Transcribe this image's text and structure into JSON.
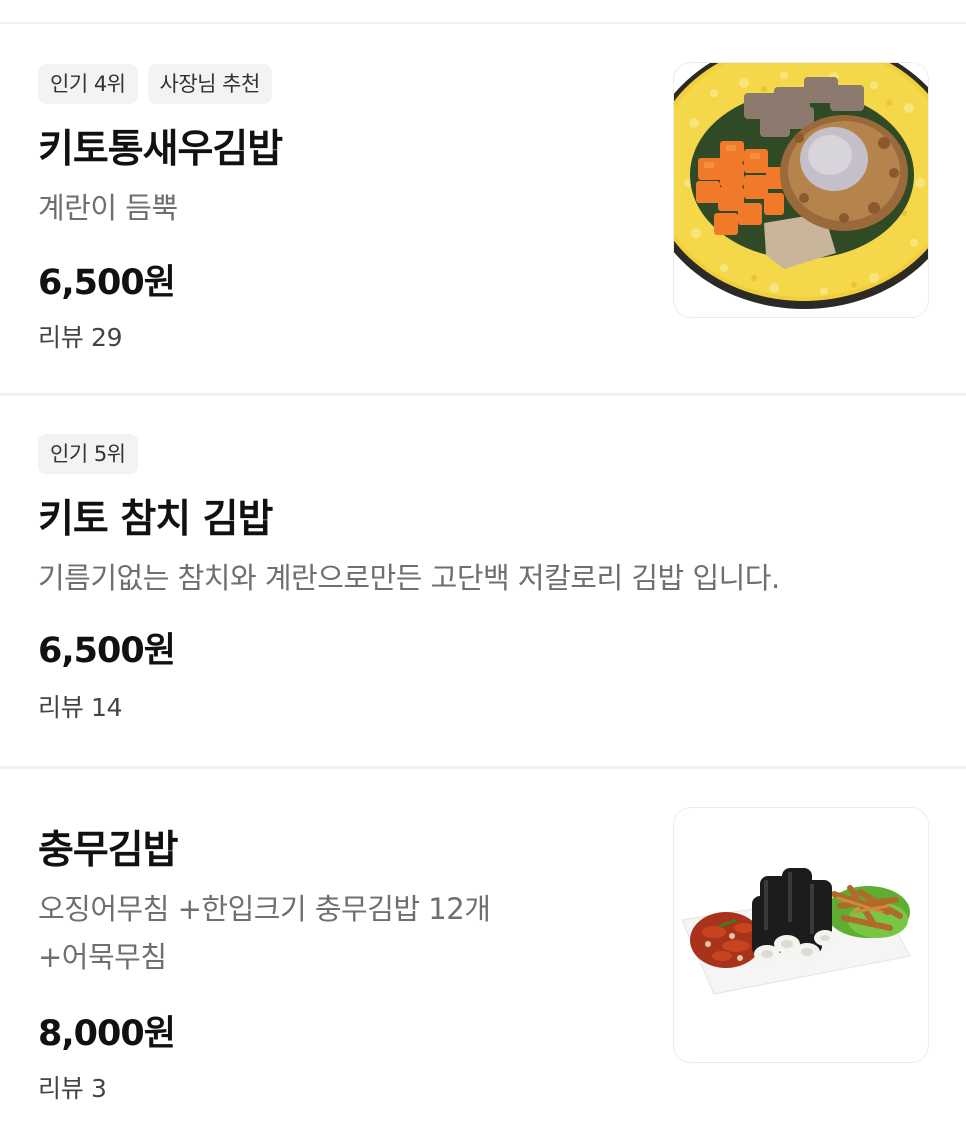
{
  "menu_items": [
    {
      "badges": [
        "인기 4위",
        "사장님 추천"
      ],
      "name": "키토통새우김밥",
      "description": "계란이 듬뿍",
      "price": "6,500원",
      "reviews": "리뷰 29",
      "image_icon": "kimbap-photo"
    },
    {
      "badges": [
        "인기 5위"
      ],
      "name": "키토 참치 김밥",
      "description": "기름기없는 참치와 계란으로만든 고단백 저칼로리 김밥 입니다.",
      "price": "6,500원",
      "reviews": "리뷰 14"
    },
    {
      "name": "충무김밥",
      "description_lines": [
        "오징어무침 +한입크기 충무김밥 12개",
        "+어묵무침"
      ],
      "price": "8,000원",
      "reviews": "리뷰 3",
      "image_icon": "chungmu-kimbap-photo"
    }
  ]
}
